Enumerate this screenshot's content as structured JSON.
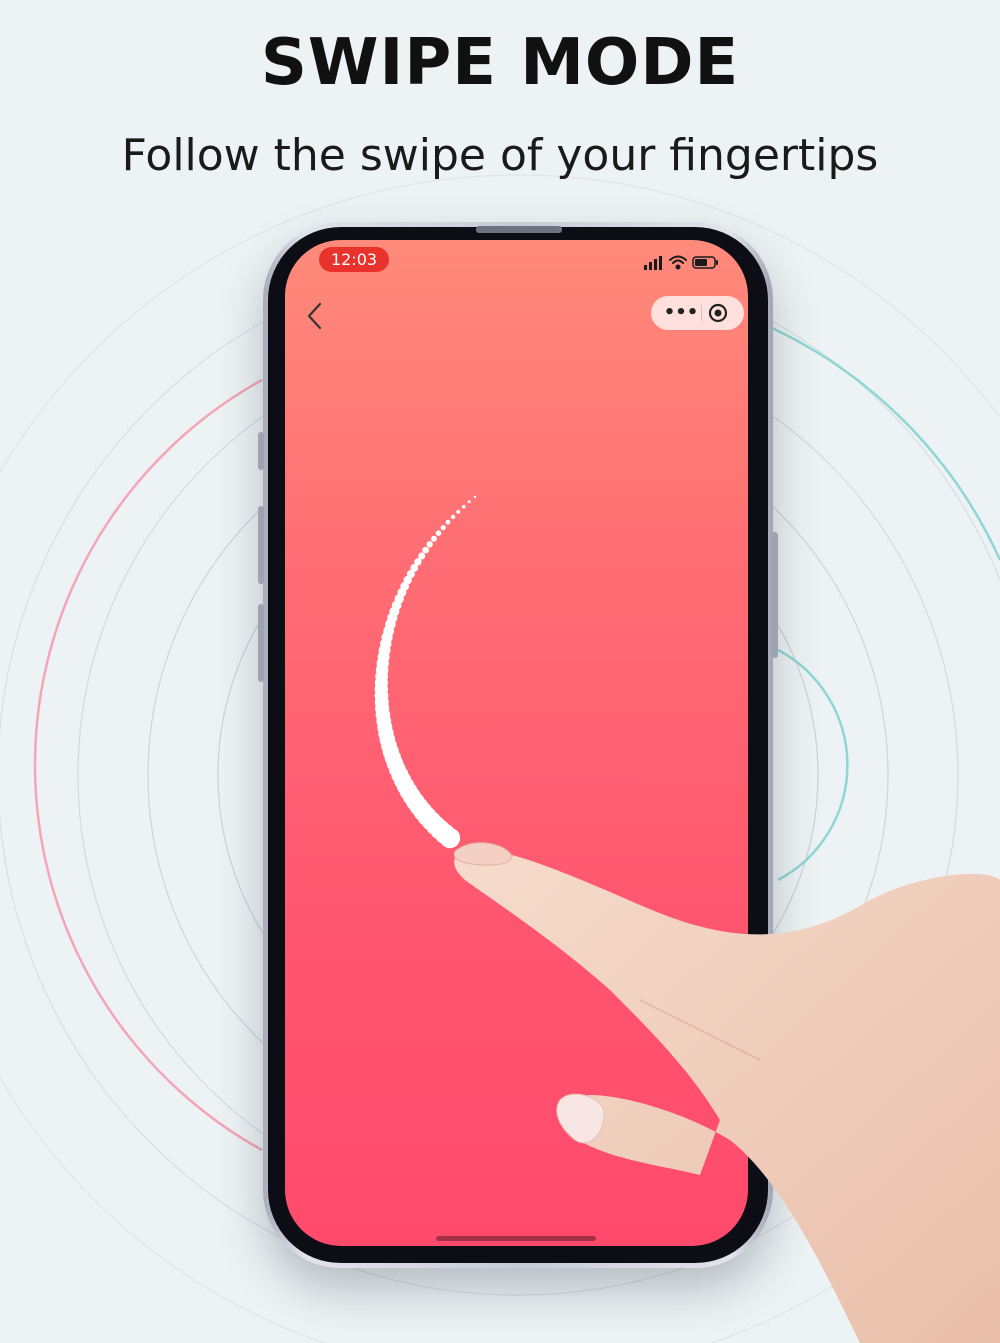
{
  "header": {
    "title": "SWIPE MODE",
    "subtitle": "Follow the swipe of your fingertips"
  },
  "status_bar": {
    "time": "12:03",
    "icons": [
      "signal-icon",
      "wifi-icon",
      "battery-icon"
    ],
    "time_pill_color": "#e8322b"
  },
  "app_bar": {
    "back_icon": "back-chevron-icon",
    "capsule_icons": [
      "more-dots-icon",
      "close-target-icon"
    ]
  },
  "theme": {
    "gradient_top": "#ff8a7a",
    "gradient_bottom": "#ff4a6c",
    "trail_color": "#ffffff"
  }
}
